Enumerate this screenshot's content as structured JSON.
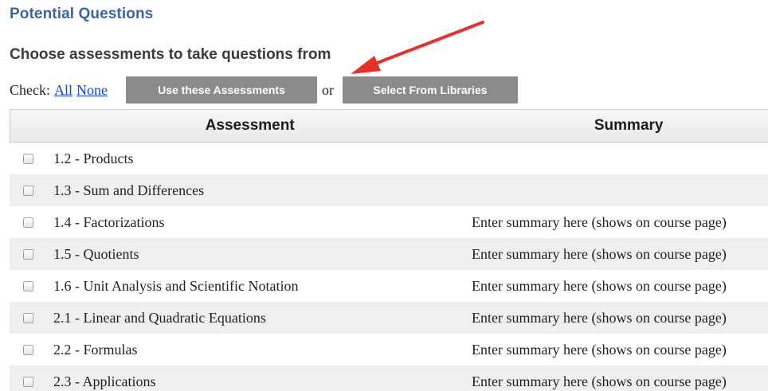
{
  "header": {
    "title": "Potential Questions",
    "subtitle": "Choose assessments to take questions from"
  },
  "check_bar": {
    "label": "Check:",
    "all_link": "All",
    "none_link": "None",
    "use_button": "Use these Assessments",
    "or_text": "or",
    "libraries_button": "Select From Libraries"
  },
  "table": {
    "columns": [
      "Assessment",
      "Summary"
    ],
    "rows": [
      {
        "name": "1.2 - Products",
        "summary": ""
      },
      {
        "name": "1.3 - Sum and Differences",
        "summary": ""
      },
      {
        "name": "1.4 - Factorizations",
        "summary": "Enter summary here (shows on course page)"
      },
      {
        "name": "1.5 - Quotients",
        "summary": "Enter summary here (shows on course page)"
      },
      {
        "name": "1.6 - Unit Analysis and Scientific Notation",
        "summary": "Enter summary here (shows on course page)"
      },
      {
        "name": "2.1 - Linear and Quadratic Equations",
        "summary": "Enter summary here (shows on course page)"
      },
      {
        "name": "2.2 - Formulas",
        "summary": "Enter summary here (shows on course page)"
      },
      {
        "name": "2.3 - Applications",
        "summary": "Enter summary here (shows on course page)"
      }
    ]
  },
  "colors": {
    "title": "#3a63ad",
    "button_bg": "#8b8b8b",
    "link": "#1a46c8",
    "annotation_arrow": "#e8302a"
  },
  "icons": {
    "annotation": "red-arrow-icon",
    "row_checkbox": "checkbox-icon"
  }
}
